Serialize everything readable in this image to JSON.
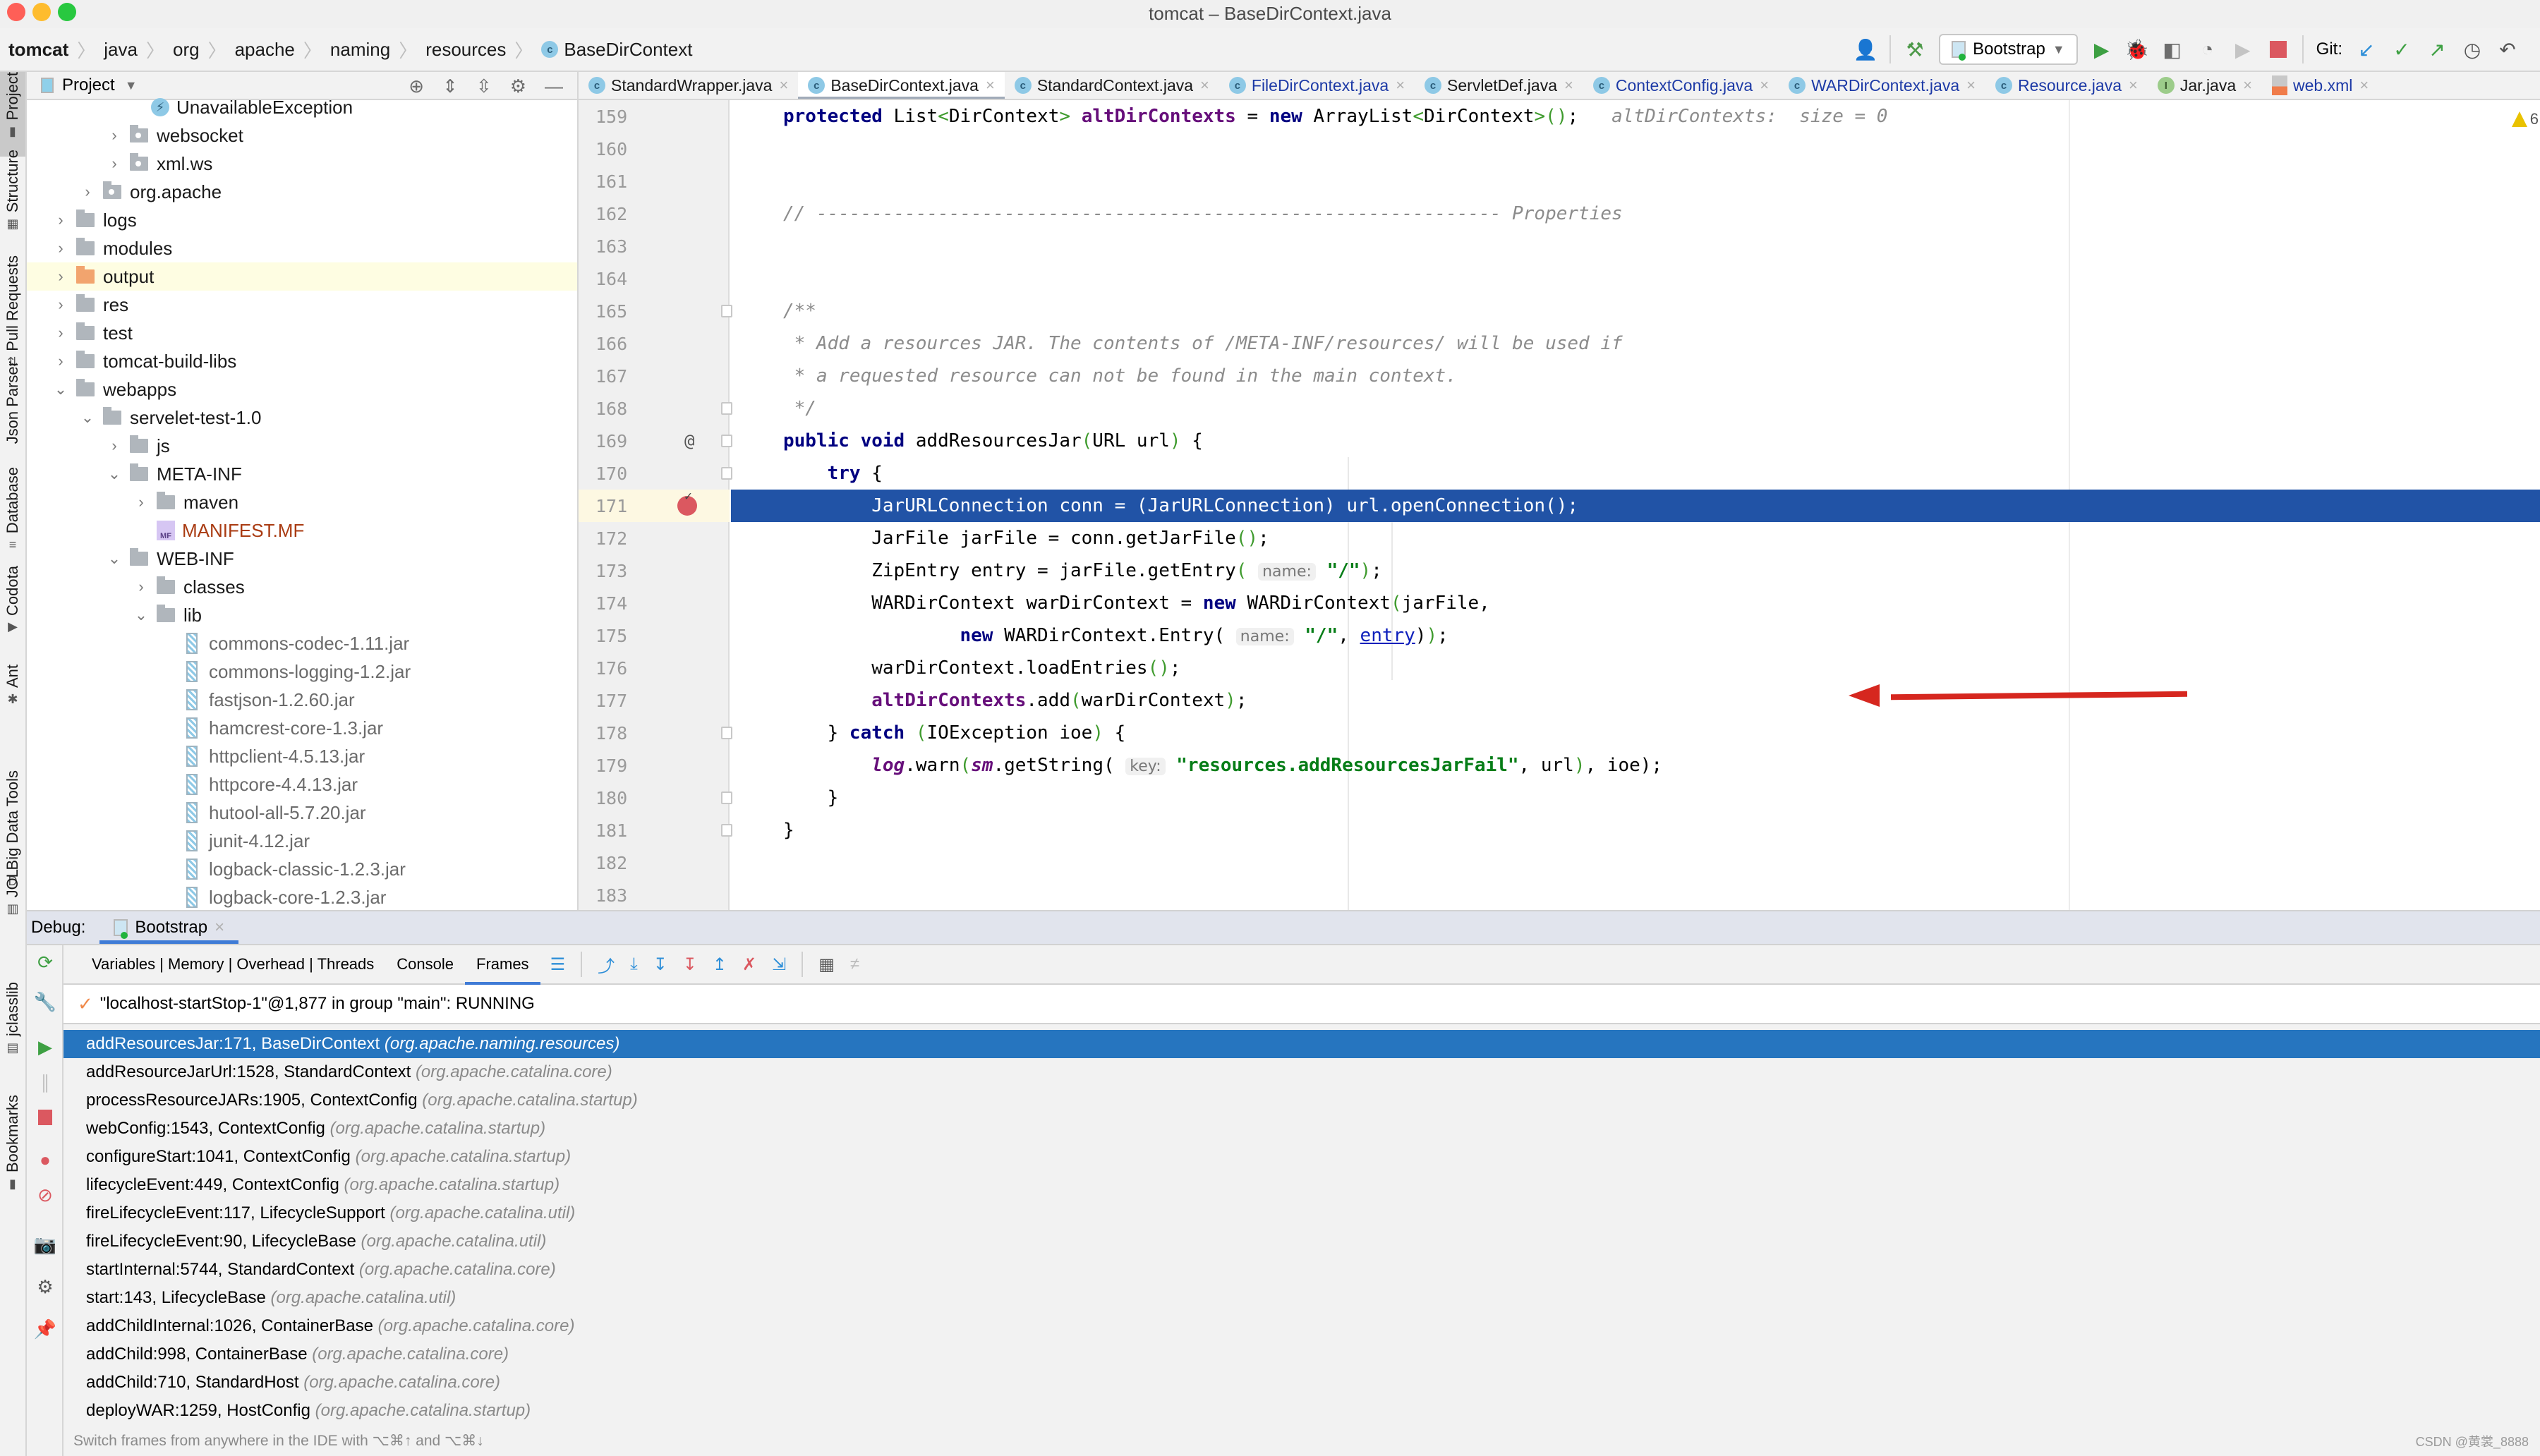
{
  "window": {
    "title": "tomcat – BaseDirContext.java"
  },
  "breadcrumb": {
    "items": [
      "tomcat",
      "java",
      "org",
      "apache",
      "naming",
      "resources",
      "BaseDirContext"
    ]
  },
  "toolbar": {
    "run_config": "Bootstrap",
    "git_label": "Git:"
  },
  "left_strip": [
    "Project",
    "Structure",
    "Pull Requests",
    "Json Parser",
    "Database",
    "Codota",
    "Ant",
    "Big Data Tools",
    "JOL",
    "jclasslib",
    "Bookmarks"
  ],
  "project": {
    "title": "Project",
    "tree": [
      {
        "label": "UnavailableException",
        "type": "exception",
        "depth": 5,
        "chevron": ""
      },
      {
        "label": "websocket",
        "type": "package",
        "depth": 4,
        "chevron": "right"
      },
      {
        "label": "xml.ws",
        "type": "package",
        "depth": 4,
        "chevron": "right"
      },
      {
        "label": "org.apache",
        "type": "package",
        "depth": 3,
        "chevron": "right"
      },
      {
        "label": "logs",
        "type": "folder",
        "depth": 2,
        "chevron": "right"
      },
      {
        "label": "modules",
        "type": "folder",
        "depth": 2,
        "chevron": "right"
      },
      {
        "label": "output",
        "type": "folder-orange",
        "depth": 2,
        "chevron": "right",
        "highlighted": true
      },
      {
        "label": "res",
        "type": "folder",
        "depth": 2,
        "chevron": "right"
      },
      {
        "label": "test",
        "type": "folder",
        "depth": 2,
        "chevron": "right"
      },
      {
        "label": "tomcat-build-libs",
        "type": "folder",
        "depth": 2,
        "chevron": "right"
      },
      {
        "label": "webapps",
        "type": "folder",
        "depth": 2,
        "chevron": "down"
      },
      {
        "label": "servelet-test-1.0",
        "type": "folder",
        "depth": 3,
        "chevron": "down"
      },
      {
        "label": "js",
        "type": "folder",
        "depth": 4,
        "chevron": "right"
      },
      {
        "label": "META-INF",
        "type": "folder",
        "depth": 4,
        "chevron": "down"
      },
      {
        "label": "maven",
        "type": "folder",
        "depth": 5,
        "chevron": "right"
      },
      {
        "label": "MANIFEST.MF",
        "type": "manifest",
        "depth": 5,
        "chevron": ""
      },
      {
        "label": "WEB-INF",
        "type": "folder",
        "depth": 4,
        "chevron": "down"
      },
      {
        "label": "classes",
        "type": "folder",
        "depth": 5,
        "chevron": "right"
      },
      {
        "label": "lib",
        "type": "folder",
        "depth": 5,
        "chevron": "down"
      },
      {
        "label": "commons-codec-1.11.jar",
        "type": "jar",
        "depth": 6,
        "chevron": ""
      },
      {
        "label": "commons-logging-1.2.jar",
        "type": "jar",
        "depth": 6,
        "chevron": ""
      },
      {
        "label": "fastjson-1.2.60.jar",
        "type": "jar",
        "depth": 6,
        "chevron": ""
      },
      {
        "label": "hamcrest-core-1.3.jar",
        "type": "jar",
        "depth": 6,
        "chevron": ""
      },
      {
        "label": "httpclient-4.5.13.jar",
        "type": "jar",
        "depth": 6,
        "chevron": ""
      },
      {
        "label": "httpcore-4.4.13.jar",
        "type": "jar",
        "depth": 6,
        "chevron": ""
      },
      {
        "label": "hutool-all-5.7.20.jar",
        "type": "jar",
        "depth": 6,
        "chevron": ""
      },
      {
        "label": "junit-4.12.jar",
        "type": "jar",
        "depth": 6,
        "chevron": ""
      },
      {
        "label": "logback-classic-1.2.3.jar",
        "type": "jar",
        "depth": 6,
        "chevron": ""
      },
      {
        "label": "logback-core-1.2.3.jar",
        "type": "jar",
        "depth": 6,
        "chevron": ""
      }
    ]
  },
  "editor_tabs": [
    {
      "label": "StandardWrapper.java",
      "icon": "class",
      "active": false,
      "modified": false
    },
    {
      "label": "BaseDirContext.java",
      "icon": "class",
      "active": true,
      "modified": false
    },
    {
      "label": "StandardContext.java",
      "icon": "class",
      "active": false,
      "modified": false
    },
    {
      "label": "FileDirContext.java",
      "icon": "class",
      "active": false,
      "modified": true
    },
    {
      "label": "ServletDef.java",
      "icon": "class",
      "active": false,
      "modified": false
    },
    {
      "label": "ContextConfig.java",
      "icon": "class",
      "active": false,
      "modified": true
    },
    {
      "label": "WARDirContext.java",
      "icon": "class",
      "active": false,
      "modified": true
    },
    {
      "label": "Resource.java",
      "icon": "class",
      "active": false,
      "modified": true
    },
    {
      "label": "Jar.java",
      "icon": "interface",
      "active": false,
      "modified": false
    },
    {
      "label": "web.xml",
      "icon": "xml",
      "active": false,
      "modified": true
    }
  ],
  "editor": {
    "warning_count": "6",
    "execution_line": 171,
    "lines": [
      {
        "n": "159",
        "html": "<span class=\"k\">protected</span> List<span class=\"pg\">&lt;</span>DirContext<span class=\"pg\">&gt;</span> <span class=\"f\">altDirContexts</span> = <span class=\"k\">new</span> ArrayList<span class=\"pg\">&lt;</span>DirContext<span class=\"pg\">&gt;()</span>;   <span class=\"inlay\">altDirContexts:  size = 0</span>"
      },
      {
        "n": "160",
        "html": ""
      },
      {
        "n": "161",
        "html": ""
      },
      {
        "n": "162",
        "html": "<span class=\"cm\">// -------------------------------------------------------------- Properties</span>"
      },
      {
        "n": "163",
        "html": ""
      },
      {
        "n": "164",
        "html": ""
      },
      {
        "n": "165",
        "html": "<span class=\"cm\">/**</span>",
        "fold": true
      },
      {
        "n": "166",
        "html": "<span class=\"cm\"> * Add a resources JAR. The contents of /META-INF/resources/ will be used if</span>"
      },
      {
        "n": "167",
        "html": "<span class=\"cm\"> * a requested resource can not be found in the main context.</span>"
      },
      {
        "n": "168",
        "html": "<span class=\"cm\"> */</span>",
        "fold": true
      },
      {
        "n": "169",
        "html": "<span class=\"k\">public void</span> addResourcesJar<span class=\"pg\">(</span>URL url<span class=\"pg\">)</span> {",
        "fold": true,
        "gutter_icon": "@"
      },
      {
        "n": "170",
        "html": "    <span class=\"k\">try</span> {",
        "fold": true
      },
      {
        "n": "171",
        "html": "        JarURLConnection conn = (JarURLConnection) url.openConnection();",
        "exec": true,
        "breakpoint": true
      },
      {
        "n": "172",
        "html": "        JarFile jarFile = conn.getJarFile<span class=\"pg\">()</span>;"
      },
      {
        "n": "173",
        "html": "        ZipEntry entry = jarFile.getEntry<span class=\"pg\">(</span> <span class=\"hint\">name:</span> <span class=\"s\">\"/\"</span><span class=\"pg\">)</span>;"
      },
      {
        "n": "174",
        "html": "        WARDirContext warDirContext = <span class=\"k\">new</span> WARDirContext<span class=\"pg\">(</span>jarFile,"
      },
      {
        "n": "175",
        "html": "                <span class=\"k\">new</span> WARDirContext.Entry( <span class=\"hint\">name:</span> <span class=\"s\">\"/\"</span>, <span class=\"link\">entry</span>)<span class=\"pg\">)</span>;"
      },
      {
        "n": "176",
        "html": "        warDirContext.loadEntries<span class=\"pg\">()</span>;"
      },
      {
        "n": "177",
        "html": "        <span class=\"f\">altDirContexts</span>.add<span class=\"pg\">(</span>warDirContext<span class=\"pg\">)</span>;",
        "arrow": true
      },
      {
        "n": "178",
        "html": "    } <span class=\"k\">catch</span> <span class=\"pg\">(</span>IOException ioe<span class=\"pg\">)</span> {",
        "fold": true
      },
      {
        "n": "179",
        "html": "        <span class=\"fi\">log</span>.warn<span class=\"pg\">(</span><span class=\"fi\">sm</span>.getString( <span class=\"hint\">key:</span> <span class=\"s\">\"resources.addResourcesJarFail\"</span>, url<span class=\"pg\">)</span>, ioe);"
      },
      {
        "n": "180",
        "html": "    }",
        "fold": true
      },
      {
        "n": "181",
        "html": "}",
        "fold": true
      },
      {
        "n": "182",
        "html": ""
      },
      {
        "n": "183",
        "html": ""
      }
    ]
  },
  "debug": {
    "label": "Debug:",
    "session_tab": "Bootstrap",
    "tabs": [
      {
        "label": "Variables | Memory | Overhead | Threads",
        "active": false
      },
      {
        "label": "Console",
        "active": false
      },
      {
        "label": "Frames",
        "active": true
      }
    ],
    "thread_status": "\"localhost-startStop-1\"@1,877 in group \"main\": RUNNING",
    "frames": [
      {
        "method": "addResourcesJar:171, BaseDirContext",
        "package": "(org.apache.naming.resources)",
        "selected": true
      },
      {
        "method": "addResourceJarUrl:1528, StandardContext",
        "package": "(org.apache.catalina.core)"
      },
      {
        "method": "processResourceJARs:1905, ContextConfig",
        "package": "(org.apache.catalina.startup)"
      },
      {
        "method": "webConfig:1543, ContextConfig",
        "package": "(org.apache.catalina.startup)"
      },
      {
        "method": "configureStart:1041, ContextConfig",
        "package": "(org.apache.catalina.startup)"
      },
      {
        "method": "lifecycleEvent:449, ContextConfig",
        "package": "(org.apache.catalina.startup)"
      },
      {
        "method": "fireLifecycleEvent:117, LifecycleSupport",
        "package": "(org.apache.catalina.util)"
      },
      {
        "method": "fireLifecycleEvent:90, LifecycleBase",
        "package": "(org.apache.catalina.util)"
      },
      {
        "method": "startInternal:5744, StandardContext",
        "package": "(org.apache.catalina.core)"
      },
      {
        "method": "start:143, LifecycleBase",
        "package": "(org.apache.catalina.util)"
      },
      {
        "method": "addChildInternal:1026, ContainerBase",
        "package": "(org.apache.catalina.core)"
      },
      {
        "method": "addChild:998, ContainerBase",
        "package": "(org.apache.catalina.core)"
      },
      {
        "method": "addChild:710, StandardHost",
        "package": "(org.apache.catalina.core)"
      },
      {
        "method": "deployWAR:1259, HostConfig",
        "package": "(org.apache.catalina.startup)"
      }
    ],
    "hint": "Switch frames from anywhere in the IDE with ⌥⌘↑ and ⌥⌘↓"
  },
  "watermark": "CSDN @黄裳_8888",
  "colors": {
    "execution_line": "#2153a6",
    "selected_frame": "#2675bf",
    "breakpoint": "#db5860",
    "annotation_arrow": "#d6271f"
  }
}
